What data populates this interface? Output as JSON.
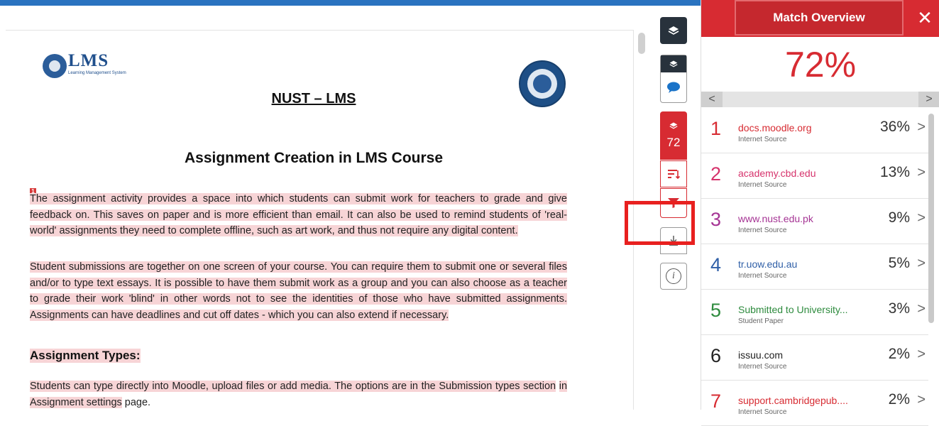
{
  "document": {
    "logo_text": "LMS",
    "logo_subtext": "Learning Management System",
    "title": "NUST – LMS",
    "subtitle": "Assignment Creation in LMS Course",
    "marker": "1",
    "para1": "The assignment activity provides a space into which students can submit work for teachers to grade and give feedback on. This saves on paper and is more efficient than email. It can also be used to remind students of 'real-world' assignments they need to complete offline, such as art work, and thus not require any digital content.",
    "para2": "Student submissions are together on one screen of your course. You can require them to submit one or several files and/or to type text essays. It is possible to have them submit work as a group and you can also choose as a teacher to grade their work 'blind' in other words not to see the identities of those who have submitted assignments. Assignments can have deadlines and cut off dates - which you can also extend if necessary.",
    "heading": "Assignment Types:",
    "para3_part1": "Students can type directly into Moodle, upload files or add media. The options are in the Submission types section",
    "para3_part2": "in Assignment settings",
    "para3_part3": " page."
  },
  "toolbar": {
    "score": "72",
    "info_icon": "i",
    "icons": [
      "layers-icon",
      "comment-icon",
      "filter-icon",
      "funnel-icon",
      "download-icon",
      "info-icon"
    ]
  },
  "panel": {
    "title": "Match Overview",
    "close": "✕",
    "overall": "72%",
    "nav_prev": "<",
    "nav_next": ">",
    "sources": [
      {
        "num": "1",
        "name": "docs.moodle.org",
        "type": "Internet Source",
        "pct": "36%",
        "color": "#d72b32"
      },
      {
        "num": "2",
        "name": "academy.cbd.edu",
        "type": "Internet Source",
        "pct": "13%",
        "color": "#d6336c"
      },
      {
        "num": "3",
        "name": "www.nust.edu.pk",
        "type": "Internet Source",
        "pct": "9%",
        "color": "#a53494"
      },
      {
        "num": "4",
        "name": "tr.uow.edu.au",
        "type": "Internet Source",
        "pct": "5%",
        "color": "#2f5fa7"
      },
      {
        "num": "5",
        "name": "Submitted to University...",
        "type": "Student Paper",
        "pct": "3%",
        "color": "#2e8b3e"
      },
      {
        "num": "6",
        "name": "issuu.com",
        "type": "Internet Source",
        "pct": "2%",
        "color": "#222222"
      },
      {
        "num": "7",
        "name": "support.cambridgepub....",
        "type": "Internet Source",
        "pct": "2%",
        "color": "#d72b32"
      }
    ],
    "chevron": ">"
  }
}
